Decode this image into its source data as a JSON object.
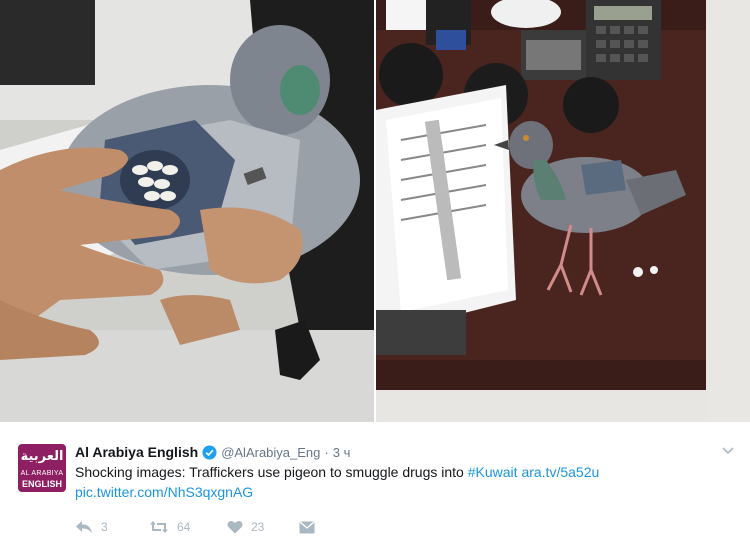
{
  "media": {
    "left_photo_icon": "pigeon-drug-backpack-photo",
    "right_photo_icon": "pigeon-on-desk-photo"
  },
  "tweet": {
    "avatar": {
      "arabic": "العربية",
      "line1": "AL ARABIYA",
      "line2": "ENGLISH",
      "color": "#8e1f63"
    },
    "author_name": "Al Arabiya English",
    "handle": "@AlArabiya_Eng",
    "separator": "·",
    "time": "3 ч",
    "text_main": "Shocking images: Traffickers use pigeon to smuggle drugs into ",
    "hashtag": "#Kuwait",
    "url": "ara.tv/5a52u",
    "pic_link": "pic.twitter.com/NhS3qxgnAG",
    "actions": {
      "reply_count": "3",
      "retweet_count": "64",
      "like_count": "23"
    },
    "colors": {
      "link": "#1b95e0",
      "secondary": "#657786",
      "action": "#aab8c2"
    }
  }
}
